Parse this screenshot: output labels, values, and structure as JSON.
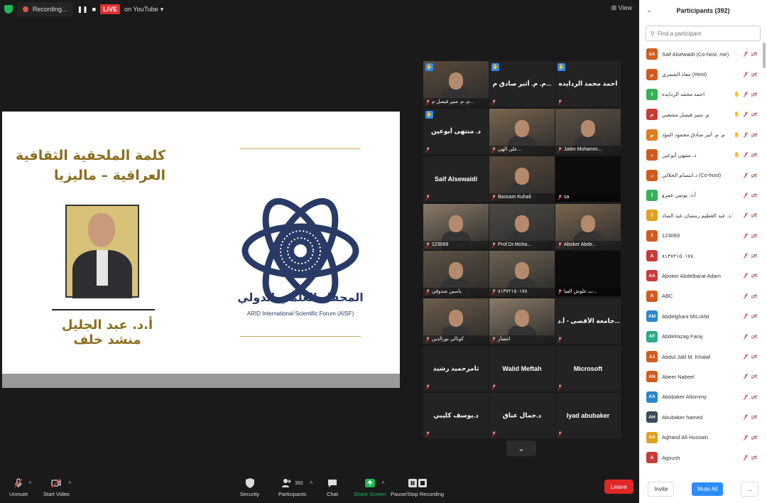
{
  "topbar": {
    "recording_label": "Recording...",
    "live_label": "LIVE",
    "stream_target": "on YouTube",
    "view_label": "View"
  },
  "shared_screen": {
    "title_line1": "كلمة الملحقية الثقافية",
    "title_line2": "العراقية – ماليزيا",
    "speaker_name": "أ.د. عبد الجليل منشد خلف",
    "org_name_ar": "المحفل العلمي الدولي",
    "org_name_en": "ARID International Scientific Forum (AISF)"
  },
  "video_tiles": [
    {
      "name": "م. م. منير فيصل م...",
      "type": "video",
      "hand": true
    },
    {
      "name": "م. م. أثير صادق م...",
      "type": "name",
      "hand": true
    },
    {
      "name": "احمد محمد الردايده",
      "type": "name",
      "hand": true
    },
    {
      "name": "د. منتهى أبوعين",
      "type": "name",
      "hand": true
    },
    {
      "name": "علي الهي...",
      "type": "video",
      "hand": false
    },
    {
      "name": "Jatim Mohamm...",
      "type": "video",
      "hand": false
    },
    {
      "name": "Saif Alsewaidi",
      "type": "name",
      "hand": false
    },
    {
      "name": "Bassam Kuhail",
      "type": "video",
      "hand": false
    },
    {
      "name": "sa",
      "type": "dark",
      "hand": false
    },
    {
      "name": "123069",
      "type": "video",
      "hand": false
    },
    {
      "name": "Prof.Dr.Moha...",
      "type": "video",
      "hand": false
    },
    {
      "name": "Aboker Abde...",
      "type": "video",
      "hand": false
    },
    {
      "name": "ياسين صدوقي",
      "type": "video",
      "hand": false
    },
    {
      "name": "٨١٣٧٢١٥٠١٧٨",
      "type": "video",
      "hand": false
    },
    {
      "name": "ب.علوش العيا...",
      "type": "dark",
      "hand": false
    },
    {
      "name": "كوثالي نورالدين",
      "type": "video",
      "hand": false
    },
    {
      "name": "انتصار",
      "type": "video",
      "hand": false
    },
    {
      "name": "جامعة الأقصى - أ.د...",
      "type": "name",
      "hand": false
    },
    {
      "name": "ثامرحميد رشيد",
      "type": "name",
      "hand": false
    },
    {
      "name": "Walid Meftah",
      "type": "name",
      "hand": false
    },
    {
      "name": "Microsoft",
      "type": "name",
      "hand": false
    },
    {
      "name": "د.يوسف كليبي",
      "type": "name",
      "hand": false
    },
    {
      "name": "د.جمال عناق",
      "type": "name",
      "hand": false
    },
    {
      "name": "Iyad abubaker",
      "type": "name",
      "hand": false
    }
  ],
  "participants_panel": {
    "title": "Participants (392)",
    "search_placeholder": "Find a participant",
    "invite_label": "Invite",
    "mute_all_label": "Mute All",
    "more_label": "...",
    "participants": [
      {
        "initials": "SA",
        "name": "Saif Alsewaidi (Co-host, me)",
        "color": "#d35a1e",
        "hand": false
      },
      {
        "initials": "م",
        "name": "معاذ الشمري (Host)",
        "color": "#d35a1e",
        "hand": false
      },
      {
        "initials": "ا",
        "name": "احمد محمد الردايده",
        "color": "#36b05a",
        "hand": true
      },
      {
        "initials": "م",
        "name": "م. منير فيصل مشعبي",
        "color": "#c93b3b",
        "hand": true
      },
      {
        "initials": "م",
        "name": "م. م. أثير صادق محمود المؤذ",
        "color": "#e07b20",
        "hand": true
      },
      {
        "initials": "د",
        "name": "د. منتهى أبوعين",
        "color": "#d35a1e",
        "hand": true
      },
      {
        "initials": "د",
        "name": "د.ابتسام الحلالي (Co-host)",
        "color": "#d35a1e",
        "hand": false
      },
      {
        "initials": "أ",
        "name": "أ.د. يونس عمرو",
        "color": "#36b05a",
        "hand": false
      },
      {
        "initials": "أ",
        "name": "أ.د. عبد العظيم رمضان عبد الصاد",
        "color": "#e0a020",
        "hand": false
      },
      {
        "initials": "1",
        "name": "123069",
        "color": "#d35a1e",
        "hand": false
      },
      {
        "initials": "A",
        "name": "٨١٣٧٢١٥٠١٧٨",
        "color": "#c93b3b",
        "hand": false
      },
      {
        "initials": "AA",
        "name": "Aboker Abdelbarat Adam",
        "color": "#c93b3b",
        "hand": false
      },
      {
        "initials": "A",
        "name": "ABC",
        "color": "#d35a1e",
        "hand": false
      },
      {
        "initials": "AM",
        "name": "Abdelghani MILIANI",
        "color": "#2a86c9",
        "hand": false
      },
      {
        "initials": "AF",
        "name": "Abdelrazag Faraj",
        "color": "#2aaa8a",
        "hand": false
      },
      {
        "initials": "AJ",
        "name": "Abdul Jalil M. Khalaf",
        "color": "#d35a1e",
        "hand": false
      },
      {
        "initials": "AN",
        "name": "Abeer Nabeel",
        "color": "#d35a1e",
        "hand": false
      },
      {
        "initials": "AA",
        "name": "Abobaker Altommy",
        "color": "#2a86c9",
        "hand": false
      },
      {
        "initials": "AH",
        "name": "Abubaker hamed",
        "color": "#3a4a5a",
        "hand": false
      },
      {
        "initials": "AA",
        "name": "Aghand Ali Hussain",
        "color": "#e0a020",
        "hand": false
      },
      {
        "initials": "A",
        "name": "Agoush",
        "color": "#c93b3b",
        "hand": false
      }
    ]
  },
  "toolbar": {
    "unmute_label": "Unmute",
    "start_video_label": "Start Video",
    "security_label": "Security",
    "participants_label": "Participants",
    "participants_count": "392",
    "chat_label": "Chat",
    "share_screen_label": "Share Screen",
    "recording_label": "Pause/Stop Recording",
    "leave_label": "Leave"
  },
  "colors": {
    "accent_blue": "#2d8cff",
    "share_green": "#1db954",
    "leave_red": "#e02828",
    "gold_text": "#8b6d1e",
    "navy": "#2a3a66"
  }
}
